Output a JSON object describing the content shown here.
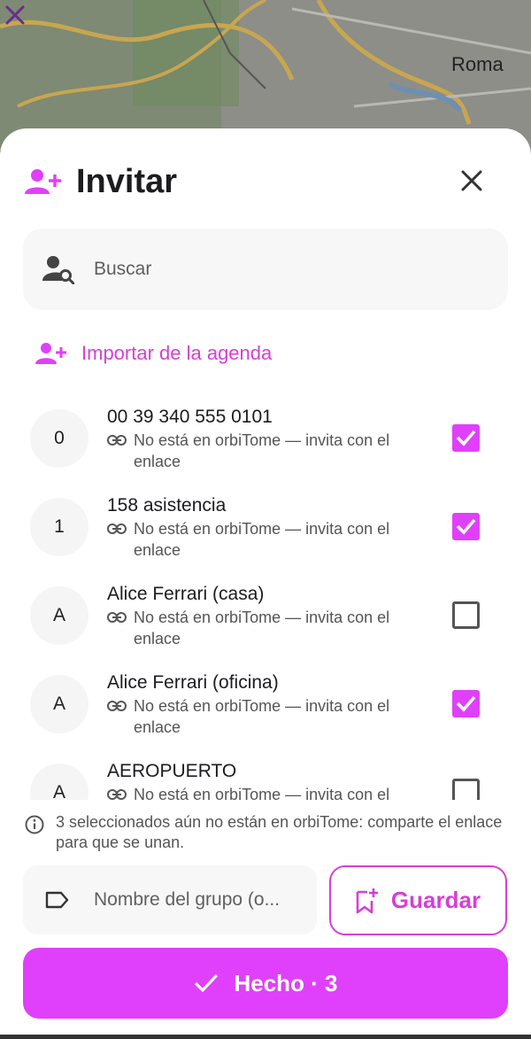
{
  "map": {
    "label": "Roma"
  },
  "header": {
    "title": "Invitar"
  },
  "search": {
    "placeholder": "Buscar"
  },
  "import": {
    "label": "Importar de la agenda"
  },
  "contacts": [
    {
      "initial": "0",
      "name": "00 39 340 555 0101",
      "status": "No está en orbiTome — invita con el enlace",
      "selected": true
    },
    {
      "initial": "1",
      "name": "158 asistencia",
      "status": "No está en orbiTome — invita con el enlace",
      "selected": true
    },
    {
      "initial": "A",
      "name": "Alice Ferrari (casa)",
      "status": "No está en orbiTome — invita con el enlace",
      "selected": false
    },
    {
      "initial": "A",
      "name": "Alice Ferrari (oficina)",
      "status": "No está en orbiTome — invita con el enlace",
      "selected": true
    },
    {
      "initial": "A",
      "name": "AEROPUERTO",
      "status": "No está en orbiTome — invita con el enlace",
      "selected": false
    }
  ],
  "notice": {
    "text": "3 seleccionados aún no están en orbiTome: comparte el enlace para que se unan."
  },
  "group": {
    "placeholder": "Nombre del grupo (o..."
  },
  "save": {
    "label": "Guardar"
  },
  "done": {
    "label": "Hecho · 3"
  },
  "colors": {
    "accent": "#e040fb",
    "accent_text": "#d63fd6"
  }
}
